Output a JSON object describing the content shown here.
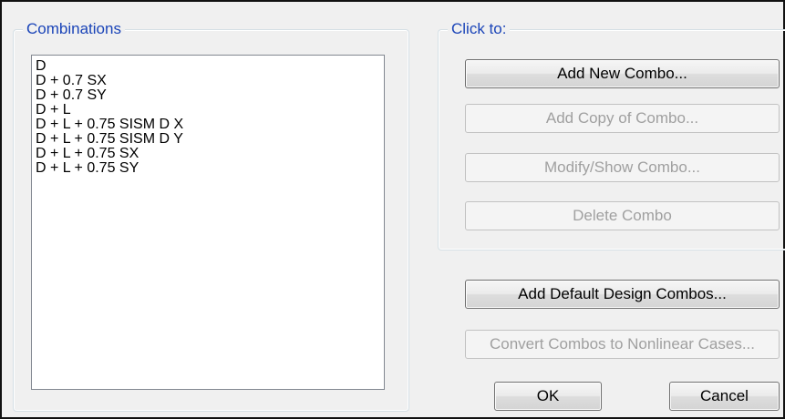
{
  "combinations_group": {
    "title": "Combinations",
    "items": [
      "D",
      "D + 0.7 SX",
      "D + 0.7 SY",
      "D + L",
      "D + L + 0.75 SISM D X",
      "D + L + 0.75 SISM D Y",
      "D + L + 0.75 SX",
      "D + L + 0.75 SY"
    ]
  },
  "click_group": {
    "title": "Click to:",
    "add_new": "Add New Combo...",
    "add_copy": "Add Copy of Combo...",
    "modify_show": "Modify/Show Combo...",
    "delete": "Delete Combo"
  },
  "add_default": "Add Default Design Combos...",
  "convert": "Convert Combos to Nonlinear Cases...",
  "ok": "OK",
  "cancel": "Cancel"
}
